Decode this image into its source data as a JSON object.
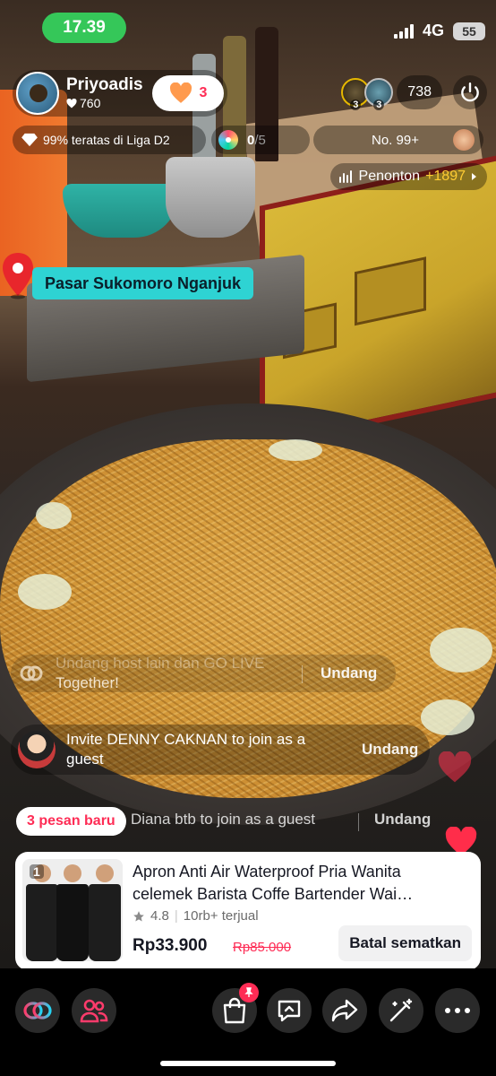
{
  "status_bar": {
    "time": "17.39",
    "network": "4G",
    "battery": "55"
  },
  "host": {
    "name": "Priyoadis",
    "likes": "760",
    "follow_count": "3"
  },
  "viewers": {
    "avatar_badges": [
      "3",
      "3"
    ],
    "count": "738"
  },
  "rank": {
    "text": "99% teratas di Liga D2"
  },
  "match": {
    "score_a": "0",
    "score_b": "/5"
  },
  "leaderboard": {
    "label": "No. 99+"
  },
  "penonton": {
    "label": "Penonton",
    "plus": "+1897"
  },
  "location": {
    "name": "Pasar Sukomoro Nganjuk"
  },
  "comments": {
    "faded_line1": "Undang host lain dan GO LIVE",
    "faded_line2": "Together!",
    "faded_action": "Undang",
    "main_line1": "Invite DENNY CAKNAN to join as a",
    "main_line2": "guest",
    "main_action": "Undang"
  },
  "new_messages": {
    "label": "3 pesan baru",
    "ticker": "Diana btb to join as a guest",
    "ticker_action": "Undang"
  },
  "product": {
    "index": "1",
    "title_line1": "Apron Anti Air Waterproof Pria Wanita",
    "title_line2": "celemek Barista Coffe Bartender Wai…",
    "rating": "4.8",
    "sold": "10rb+ terjual",
    "price": "Rp33.900",
    "old_price": "Rp85.000",
    "unpin_label": "Batal sematkan"
  },
  "bottom_bar": {
    "icons": [
      "link-icon",
      "guests-icon",
      "shop-icon",
      "message-icon",
      "share-icon",
      "magic-wand-icon",
      "more-icon"
    ]
  },
  "colors": {
    "accent": "#fe2c55",
    "time_pill": "#35c759",
    "location_pill": "#2ed3d3",
    "viewers_plus": "#ffcc33"
  }
}
